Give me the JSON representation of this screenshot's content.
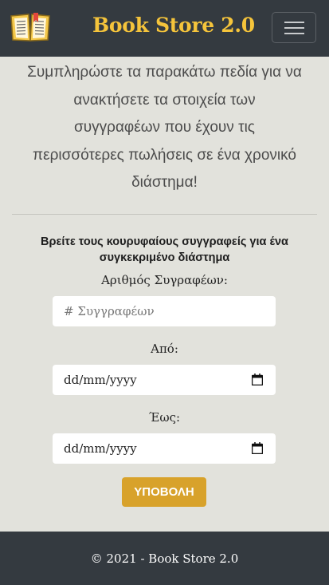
{
  "navbar": {
    "brand": "Book Store 2.0",
    "logo_icon": "open-book-icon",
    "menu_icon": "hamburger-menu-icon",
    "brand_color": "#f5c43b",
    "background": "#343a40"
  },
  "intro": {
    "lines": [
      "Συμπληρώστε τα παρακάτω πεδία για να",
      "ανακτήσετε τα στοιχεία των",
      "συγγραφέων που έχουν τις",
      "περισσότερες πωλήσεις σε ένα χρονικό",
      "διάστημα!"
    ]
  },
  "form": {
    "heading_lines": [
      "Βρείτε τους κουρυφαίους συγγραφείς για ένα",
      "συγκεκριμένο διάστημα"
    ],
    "authors_label": "Αριθμός Συγραφέων:",
    "authors_placeholder": "# Συγγραφέων",
    "from_label": "Από:",
    "from_value": "dd/mm/yyyy",
    "to_label": "Έως:",
    "to_value": "dd/mm/yyyy",
    "calendar_icon": "calendar-icon",
    "submit_label": "ΥΠΟΒΟΛΗ",
    "submit_color": "#d8a22b"
  },
  "footer": {
    "text": "© 2021 - Book Store 2.0"
  }
}
